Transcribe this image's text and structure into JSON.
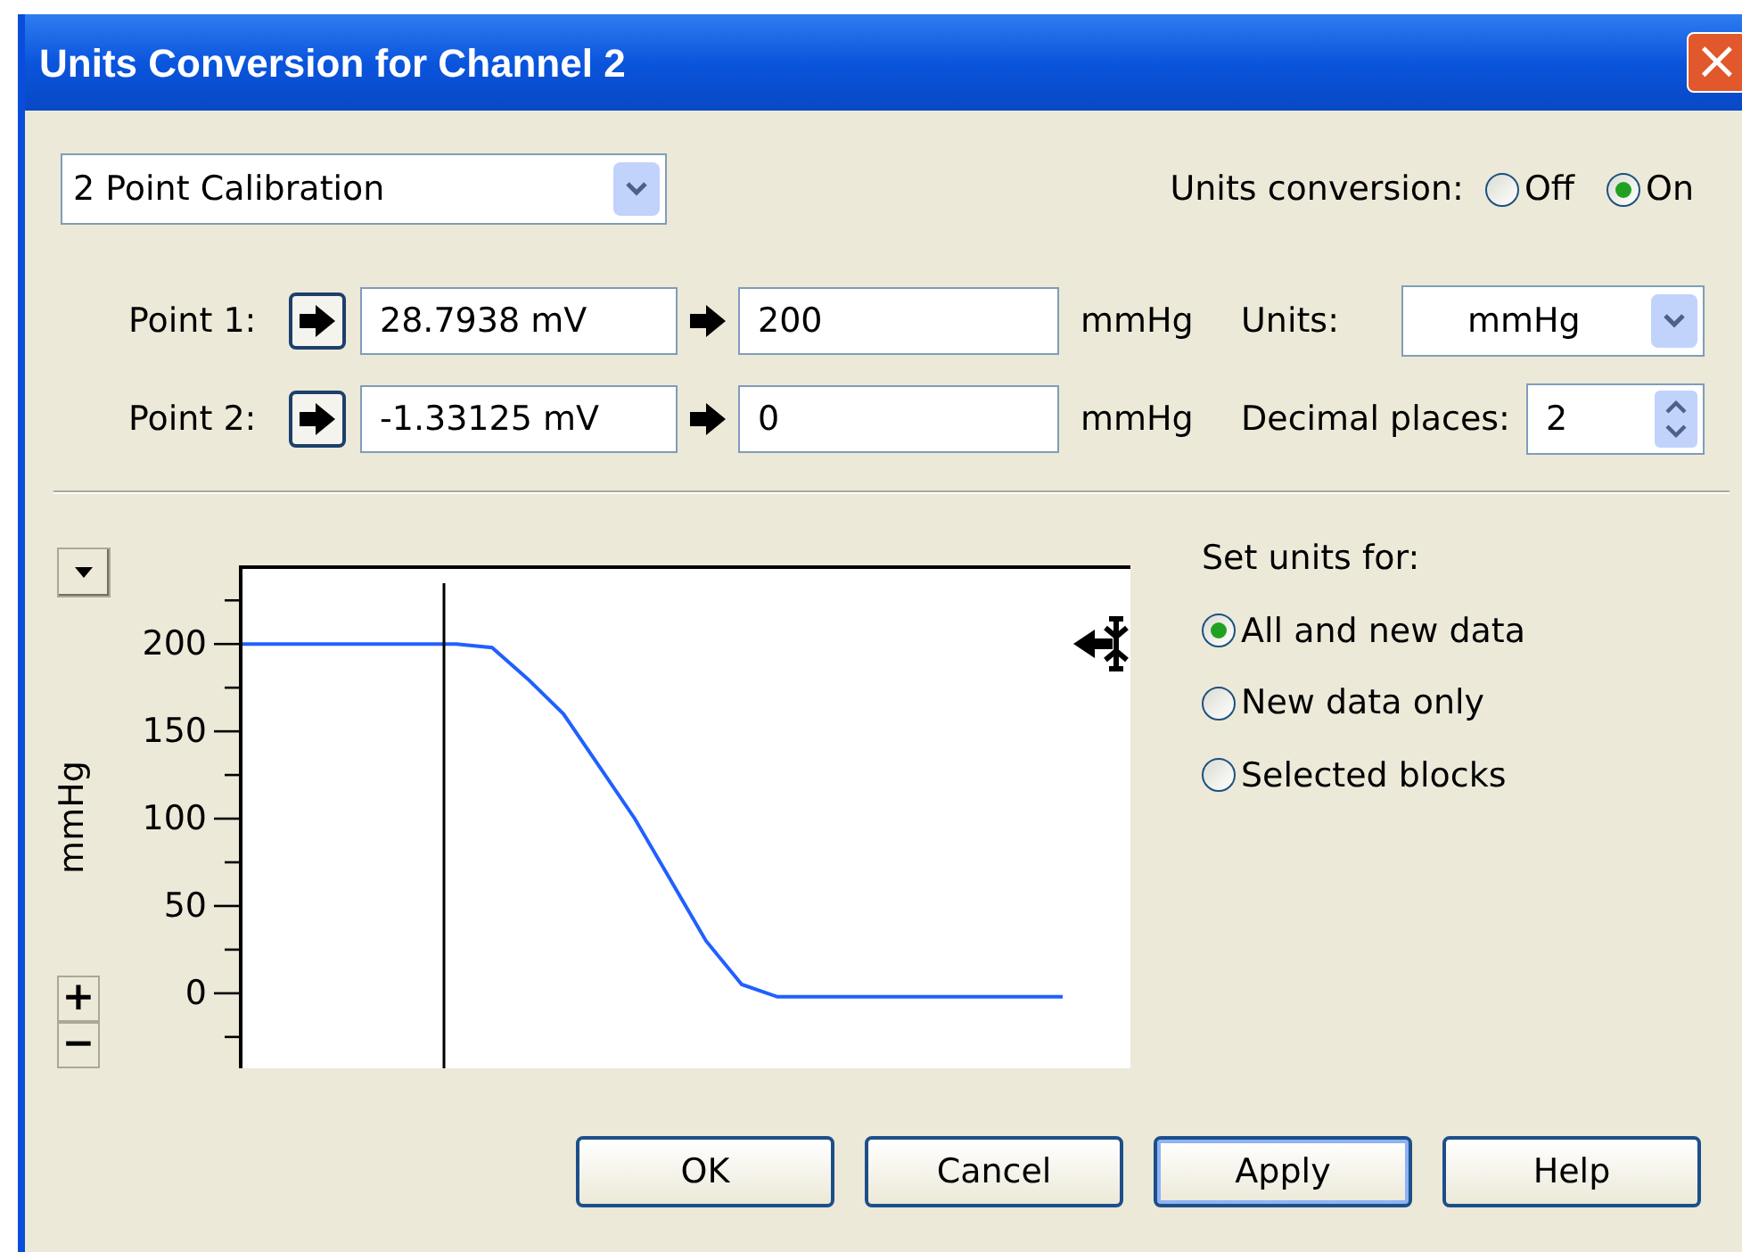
{
  "window": {
    "title": "Units Conversion for Channel 2",
    "close": "×"
  },
  "method": {
    "value": "2 Point Calibration"
  },
  "units_conversion": {
    "label": "Units conversion:",
    "options": [
      {
        "label": "Off",
        "selected": false
      },
      {
        "label": "On",
        "selected": true
      }
    ]
  },
  "points": [
    {
      "label": "Point 1:",
      "raw": "28.7938 mV",
      "value": "200",
      "unit": "mmHg"
    },
    {
      "label": "Point 2:",
      "raw": "-1.33125 mV",
      "value": "0",
      "unit": "mmHg"
    }
  ],
  "units": {
    "label": "Units:",
    "value": "mmHg"
  },
  "decimal_places": {
    "label": "Decimal places:",
    "value": "2"
  },
  "chart": {
    "zoom_in": "+",
    "zoom_out": "−",
    "chart_data": {
      "type": "line",
      "ylabel": "mmHg",
      "categories": [
        null,
        null,
        null,
        null,
        null,
        null,
        null,
        null,
        null,
        null,
        null,
        null,
        null,
        null,
        null,
        null,
        null,
        null,
        null,
        null,
        null,
        null,
        null,
        null
      ],
      "ylim": [
        -45,
        243
      ],
      "yticks": [
        0,
        50,
        100,
        150,
        200
      ],
      "series": [
        {
          "color": "#2060ff",
          "values": [
            200,
            200,
            200,
            200,
            200,
            200,
            200,
            198,
            180,
            160,
            130,
            100,
            65,
            30,
            5,
            -2,
            -2,
            -2,
            -2,
            -2,
            -2,
            -2,
            -2,
            -2
          ]
        }
      ]
    }
  },
  "set_units_for": {
    "label": "Set units for:",
    "options": [
      {
        "label": "All and new data",
        "selected": true
      },
      {
        "label": "New data only",
        "selected": false
      },
      {
        "label": "Selected blocks",
        "selected": false
      }
    ]
  },
  "buttons": [
    {
      "label": "OK",
      "focused": false
    },
    {
      "label": "Cancel",
      "focused": false
    },
    {
      "label": "Apply",
      "focused": true
    },
    {
      "label": "Help",
      "focused": false
    }
  ]
}
